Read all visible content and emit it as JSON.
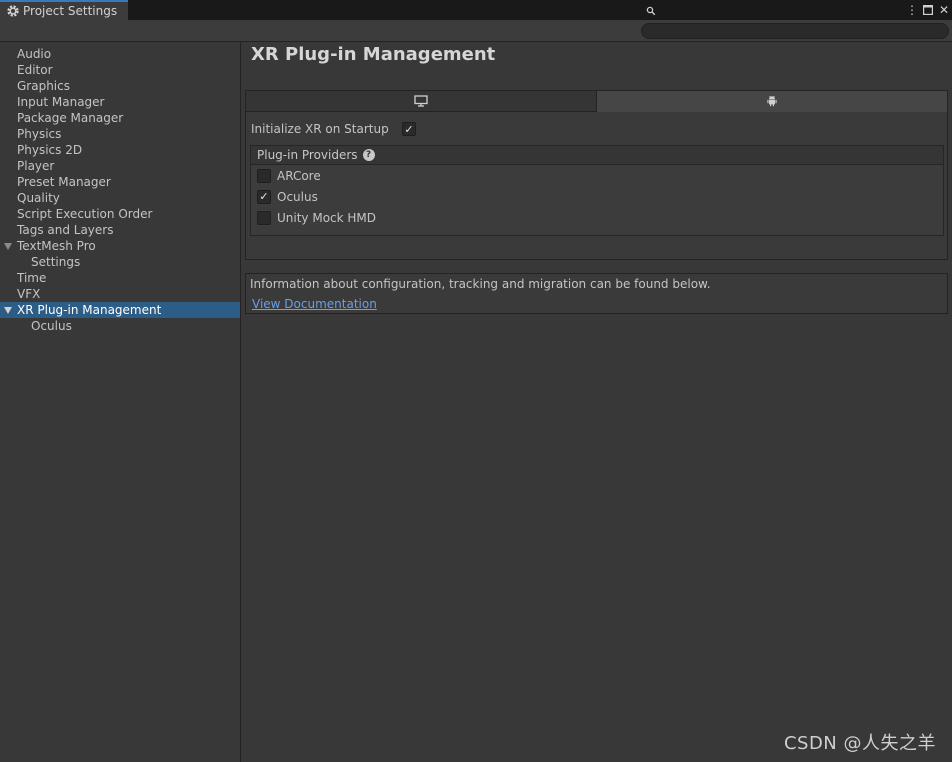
{
  "window": {
    "tab_title": "Project Settings",
    "controls": {
      "menu": "⋮",
      "maximize": "□",
      "close": "✕"
    }
  },
  "search": {
    "value": "",
    "placeholder": ""
  },
  "sidebar": {
    "items": [
      {
        "label": "Audio"
      },
      {
        "label": "Editor"
      },
      {
        "label": "Graphics"
      },
      {
        "label": "Input Manager"
      },
      {
        "label": "Package Manager"
      },
      {
        "label": "Physics"
      },
      {
        "label": "Physics 2D"
      },
      {
        "label": "Player"
      },
      {
        "label": "Preset Manager"
      },
      {
        "label": "Quality"
      },
      {
        "label": "Script Execution Order"
      },
      {
        "label": "Tags and Layers"
      },
      {
        "label": "TextMesh Pro"
      },
      {
        "label": "Settings"
      },
      {
        "label": "Time"
      },
      {
        "label": "VFX"
      },
      {
        "label": "XR Plug-in Management"
      },
      {
        "label": "Oculus"
      }
    ],
    "selected": "XR Plug-in Management"
  },
  "main": {
    "title": "XR Plug-in Management",
    "platform_tabs": [
      {
        "icon": "desktop-icon",
        "active": false
      },
      {
        "icon": "android-icon",
        "active": true
      }
    ],
    "init_label": "Initialize XR on Startup",
    "init_checked": "✓",
    "providers": {
      "header": "Plug-in Providers",
      "help": "?",
      "items": [
        {
          "label": "ARCore",
          "mark": ""
        },
        {
          "label": "Oculus",
          "mark": "✓"
        },
        {
          "label": "Unity Mock HMD",
          "mark": ""
        }
      ]
    },
    "info": {
      "text": "Information about configuration, tracking and migration can be found below.",
      "link": "View Documentation"
    }
  },
  "watermark": "CSDN @人失之羊",
  "colors": {
    "accent": "#3a79bb",
    "selection": "#2c5d87",
    "link": "#6b9fe8",
    "background": "#383838"
  }
}
